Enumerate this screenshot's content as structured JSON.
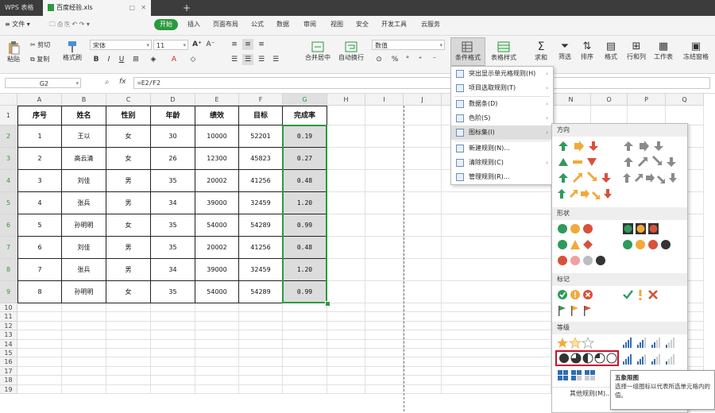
{
  "titlebar": {
    "app_tab": "WPS 表格",
    "file_tab": "百度经验.xls",
    "add_tab": "+"
  },
  "menubar": {
    "file_menu": "文件",
    "tabs": [
      "开始",
      "插入",
      "页面布局",
      "公式",
      "数据",
      "审阅",
      "视图",
      "安全",
      "开发工具",
      "云服务"
    ]
  },
  "toolbar": {
    "paste": "粘贴",
    "cut": "剪切",
    "copy": "复制",
    "format_painter": "格式刷",
    "font_name": "宋体",
    "font_size": "11",
    "merge_center": "合并居中",
    "wrap_text": "自动换行",
    "number_format": "数值",
    "conditional_format": "条件格式",
    "table_style": "表格样式",
    "sum": "求和",
    "filter": "筛选",
    "sort": "排序",
    "format": "格式",
    "rows_cols": "行和列",
    "worksheet": "工作表",
    "freeze": "冻结窗格"
  },
  "formulabar": {
    "name_box": "G2",
    "fx": "fx",
    "formula": "=E2/F2"
  },
  "columns": [
    "A",
    "B",
    "C",
    "D",
    "E",
    "F",
    "G",
    "H",
    "I",
    "J",
    "N",
    "O",
    "P",
    "Q"
  ],
  "table": {
    "headers": [
      "序号",
      "姓名",
      "性别",
      "年龄",
      "绩效",
      "目标",
      "完成率"
    ],
    "rows": [
      [
        "1",
        "王以",
        "女",
        "30",
        "10000",
        "52201",
        "0.19"
      ],
      [
        "2",
        "高云清",
        "女",
        "26",
        "12300",
        "45823",
        "0.27"
      ],
      [
        "3",
        "刘佳",
        "男",
        "35",
        "20002",
        "41256",
        "0.48"
      ],
      [
        "4",
        "张兵",
        "男",
        "34",
        "39000",
        "32459",
        "1.20"
      ],
      [
        "5",
        "孙明明",
        "女",
        "35",
        "54000",
        "54289",
        "0.99"
      ],
      [
        "6",
        "刘佳",
        "男",
        "35",
        "20002",
        "41256",
        "0.48"
      ],
      [
        "7",
        "张兵",
        "男",
        "34",
        "39000",
        "32459",
        "1.20"
      ],
      [
        "8",
        "孙明明",
        "女",
        "35",
        "54000",
        "54289",
        "0.99"
      ]
    ]
  },
  "row_numbers": [
    "1",
    "2",
    "3",
    "4",
    "5",
    "6",
    "7",
    "8",
    "9",
    "10",
    "11",
    "12",
    "13",
    "14",
    "15",
    "16",
    "17",
    "18",
    "19"
  ],
  "cf_menu": {
    "items": [
      {
        "label": "突出显示单元格规则(H)",
        "arrow": "›"
      },
      {
        "label": "项目选取规则(T)",
        "arrow": "›"
      },
      {
        "label": "数据条(D)",
        "arrow": "›"
      },
      {
        "label": "色阶(S)",
        "arrow": "›"
      },
      {
        "label": "图标集(I)",
        "arrow": "›"
      },
      {
        "label": "新建规则(N)...",
        "arrow": ""
      },
      {
        "label": "清除规则(C)",
        "arrow": "›"
      },
      {
        "label": "管理规则(R)...",
        "arrow": ""
      }
    ]
  },
  "icon_panel": {
    "sections": [
      "方向",
      "形状",
      "标记",
      "等级"
    ],
    "more_rules": "其他规则(M)...",
    "tooltip_title": "五象限图",
    "tooltip_body": "选择一组图标以代表所选单元格内的值。"
  },
  "colors": {
    "green": "#2e9a5c",
    "orange": "#f2a93b",
    "red": "#d9513a",
    "gray": "#8a8a8a",
    "accent": "#2a9a3d",
    "highlight_border": "#c8102e"
  }
}
